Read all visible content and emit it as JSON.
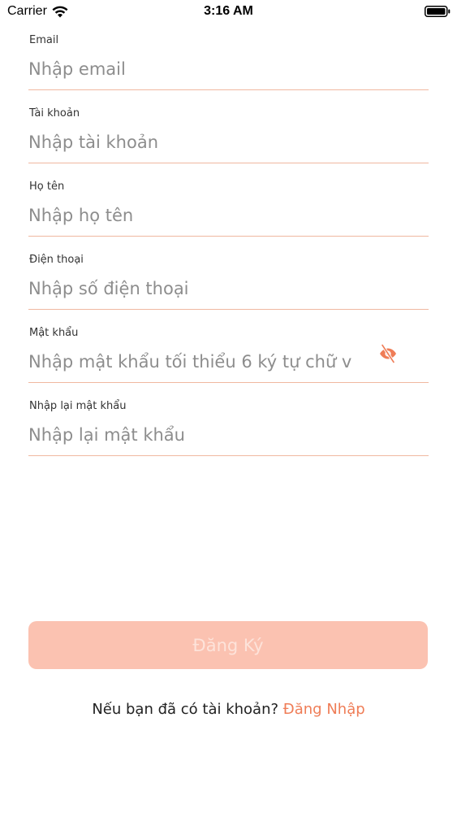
{
  "status_bar": {
    "carrier": "Carrier",
    "time": "3:16 AM",
    "icons": [
      "wifi-icon",
      "battery-icon"
    ]
  },
  "form": {
    "fields": [
      {
        "label": "Email",
        "placeholder": "Nhập email",
        "value": ""
      },
      {
        "label": "Tài khoản",
        "placeholder": "Nhập tài khoản",
        "value": ""
      },
      {
        "label": "Họ tên",
        "placeholder": "Nhập họ tên",
        "value": ""
      },
      {
        "label": "Điện thoại",
        "placeholder": "Nhập số điện thoại",
        "value": ""
      },
      {
        "label": "Mật khẩu",
        "placeholder": "Nhập mật khẩu tối thiểu 6 ký tự chữ v",
        "value": ""
      },
      {
        "label": "Nhập lại mật khẩu",
        "placeholder": "Nhập lại mật khẩu",
        "value": ""
      }
    ],
    "password_visibility_icon": "eye-off-icon"
  },
  "actions": {
    "register_label": "Đăng Ký",
    "register_enabled": false
  },
  "footer": {
    "prompt": "Nếu bạn đã có tài khoản?",
    "login_link": "Đăng Nhập"
  },
  "colors": {
    "accent": "#ef7d57",
    "button_disabled_bg": "#fbc2b1",
    "button_disabled_text": "#fde3da",
    "divider": "#f0b8a0"
  }
}
